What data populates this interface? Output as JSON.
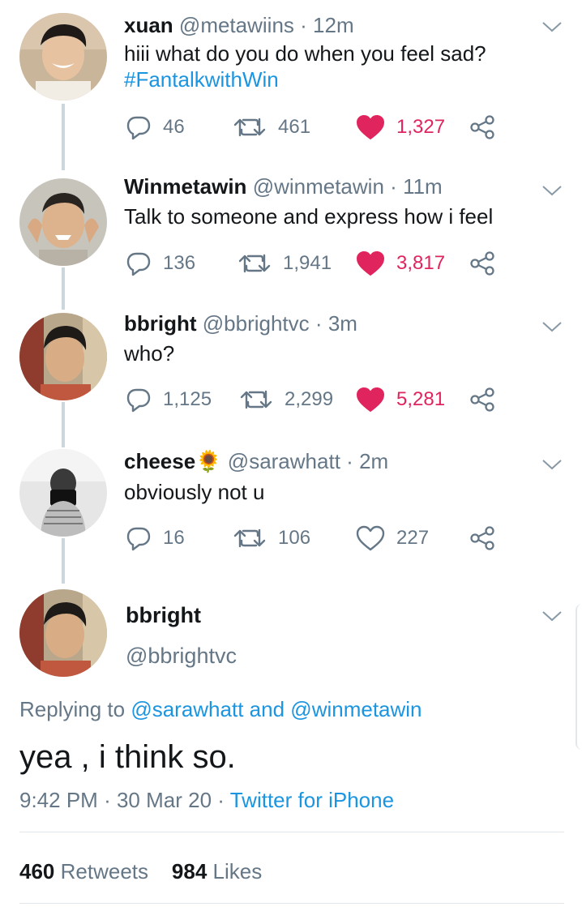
{
  "thread": [
    {
      "name": "xuan",
      "handle": "@metawiins",
      "time": "12m",
      "text_lines": [
        "hiii what do you do when you feel sad?"
      ],
      "hashtag": "#FantalkwithWin",
      "replies": "46",
      "retweets": "461",
      "likes": "1,327",
      "liked": true
    },
    {
      "name": "Winmetawin",
      "handle": "@winmetawin",
      "time": "11m",
      "text_lines": [
        "Talk to someone and express how i feel"
      ],
      "replies": "136",
      "retweets": "1,941",
      "likes": "3,817",
      "liked": true
    },
    {
      "name": "bbright",
      "handle": "@bbrightvc",
      "time": "3m",
      "text_lines": [
        "who?"
      ],
      "replies": "1,125",
      "retweets": "2,299",
      "likes": "5,281",
      "liked": true
    },
    {
      "name": "cheese",
      "name_emoji": "🌻",
      "handle": "@sarawhatt",
      "time": "2m",
      "text_lines": [
        "obviously not u"
      ],
      "replies": "16",
      "retweets": "106",
      "likes": "227",
      "liked": false
    }
  ],
  "main": {
    "name": "bbright",
    "handle": "@bbrightvc",
    "replying_prefix": "Replying to",
    "replying_user1": "@sarawhatt",
    "replying_and": "and",
    "replying_user2": "@winmetawin",
    "text": "yea , i think so.",
    "time": "9:42 PM",
    "date": "30 Mar 20",
    "source": "Twitter for iPhone",
    "retweet_count": "460",
    "retweet_label": "Retweets",
    "like_count": "984",
    "like_label": "Likes"
  },
  "icons": {
    "reply": "reply-icon",
    "retweet": "retweet-icon",
    "like": "heart-icon",
    "share": "share-icon",
    "menu": "chevron-down-icon"
  },
  "colors": {
    "accent": "#1b95e0",
    "like": "#e0245e",
    "muted": "#657786",
    "text": "#14171a",
    "thread_line": "#ccd6dd"
  }
}
